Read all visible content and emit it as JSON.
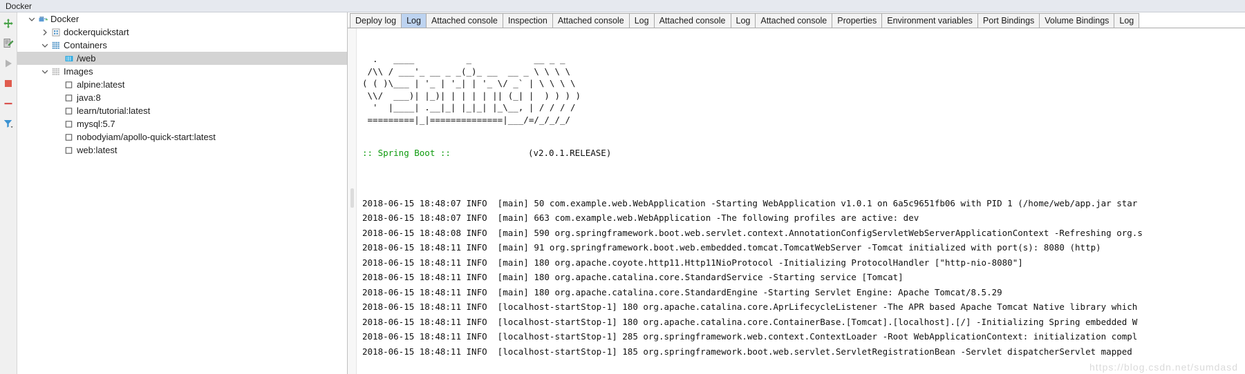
{
  "window": {
    "title": "Docker"
  },
  "toolbar": {
    "buttons": [
      {
        "name": "connect-icon",
        "tooltip": "Connect",
        "color": "#4aa34a"
      },
      {
        "name": "edit-configuration-icon",
        "tooltip": "Edit Configuration",
        "color": "#8a8a8a"
      },
      {
        "name": "run-icon",
        "tooltip": "Run",
        "color": "#b5b5b5"
      },
      {
        "name": "stop-icon",
        "tooltip": "Stop",
        "color": "#e05c4e"
      },
      {
        "name": "remove-icon",
        "tooltip": "Remove",
        "color": "#d9534f"
      },
      {
        "name": "filter-icon",
        "tooltip": "Filter",
        "color": "#3b92d1"
      }
    ]
  },
  "tree": {
    "nodes": [
      {
        "label": "Docker",
        "indent": 0,
        "twisty": "down",
        "icon": "docker-icon",
        "selected": false
      },
      {
        "label": "dockerquickstart",
        "indent": 1,
        "twisty": "right",
        "icon": "grid-small-icon",
        "selected": false
      },
      {
        "label": "Containers",
        "indent": 1,
        "twisty": "down",
        "icon": "grid-icon",
        "selected": false
      },
      {
        "label": "/web",
        "indent": 2,
        "twisty": "none",
        "icon": "container-icon",
        "selected": true
      },
      {
        "label": "Images",
        "indent": 1,
        "twisty": "down",
        "icon": "grid-dots-icon",
        "selected": false
      },
      {
        "label": "alpine:latest",
        "indent": 2,
        "twisty": "none",
        "icon": "image-icon",
        "selected": false
      },
      {
        "label": "java:8",
        "indent": 2,
        "twisty": "none",
        "icon": "image-icon",
        "selected": false
      },
      {
        "label": "learn/tutorial:latest",
        "indent": 2,
        "twisty": "none",
        "icon": "image-icon",
        "selected": false
      },
      {
        "label": "mysql:5.7",
        "indent": 2,
        "twisty": "none",
        "icon": "image-icon",
        "selected": false
      },
      {
        "label": "nobodyiam/apollo-quick-start:latest",
        "indent": 2,
        "twisty": "none",
        "icon": "image-icon",
        "selected": false
      },
      {
        "label": "web:latest",
        "indent": 2,
        "twisty": "none",
        "icon": "image-icon",
        "selected": false
      }
    ]
  },
  "tabs": [
    {
      "label": "Deploy log",
      "active": false
    },
    {
      "label": "Log",
      "active": true
    },
    {
      "label": "Attached console",
      "active": false
    },
    {
      "label": "Inspection",
      "active": false
    },
    {
      "label": "Attached console",
      "active": false
    },
    {
      "label": "Log",
      "active": false
    },
    {
      "label": "Attached console",
      "active": false
    },
    {
      "label": "Log",
      "active": false
    },
    {
      "label": "Attached console",
      "active": false
    },
    {
      "label": "Properties",
      "active": false
    },
    {
      "label": "Environment variables",
      "active": false
    },
    {
      "label": "Port Bindings",
      "active": false
    },
    {
      "label": "Volume Bindings",
      "active": false
    },
    {
      "label": "Log",
      "active": false
    }
  ],
  "log": {
    "banner": "  .   ____          _            __ _ _\n /\\\\ / ___'_ __ _ _(_)_ __  __ _ \\ \\ \\ \\\n( ( )\\___ | '_ | '_| | '_ \\/ _` | \\ \\ \\ \\\n \\\\/  ___)| |_)| | | | | || (_| |  ) ) ) )\n  '  |____| .__|_| |_|_| |_\\__, | / / / /\n =========|_|==============|___/=/_/_/_/",
    "boot_name": ":: Spring Boot ::",
    "boot_version": "(v2.0.1.RELEASE)",
    "lines": [
      "2018-06-15 18:48:07 INFO  [main] 50 com.example.web.WebApplication -Starting WebApplication v1.0.1 on 6a5c9651fb06 with PID 1 (/home/web/app.jar star",
      "2018-06-15 18:48:07 INFO  [main] 663 com.example.web.WebApplication -The following profiles are active: dev",
      "2018-06-15 18:48:08 INFO  [main] 590 org.springframework.boot.web.servlet.context.AnnotationConfigServletWebServerApplicationContext -Refreshing org.s",
      "2018-06-15 18:48:11 INFO  [main] 91 org.springframework.boot.web.embedded.tomcat.TomcatWebServer -Tomcat initialized with port(s): 8080 (http)",
      "2018-06-15 18:48:11 INFO  [main] 180 org.apache.coyote.http11.Http11NioProtocol -Initializing ProtocolHandler [\"http-nio-8080\"]",
      "2018-06-15 18:48:11 INFO  [main] 180 org.apache.catalina.core.StandardService -Starting service [Tomcat]",
      "2018-06-15 18:48:11 INFO  [main] 180 org.apache.catalina.core.StandardEngine -Starting Servlet Engine: Apache Tomcat/8.5.29",
      "2018-06-15 18:48:11 INFO  [localhost-startStop-1] 180 org.apache.catalina.core.AprLifecycleListener -The APR based Apache Tomcat Native library which",
      "2018-06-15 18:48:11 INFO  [localhost-startStop-1] 180 org.apache.catalina.core.ContainerBase.[Tomcat].[localhost].[/] -Initializing Spring embedded W",
      "2018-06-15 18:48:11 INFO  [localhost-startStop-1] 285 org.springframework.web.context.ContextLoader -Root WebApplicationContext: initialization compl",
      "2018-06-15 18:48:11 INFO  [localhost-startStop-1] 185 org.springframework.boot.web.servlet.ServletRegistrationBean -Servlet dispatcherServlet mapped"
    ],
    "watermark": "https://blog.csdn.net/sumdasd"
  },
  "colors": {
    "selection": "#d4d4d4",
    "active_tab": "#bdd3f0",
    "spring_green": "#0d9a0d",
    "title_bg": "#e6e9ef"
  }
}
